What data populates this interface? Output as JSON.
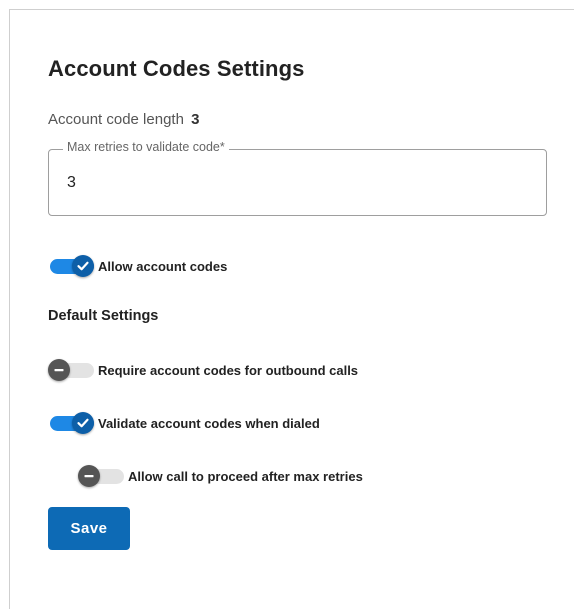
{
  "page": {
    "title": "Account Codes Settings"
  },
  "account_code_length": {
    "label": "Account code length",
    "value": "3"
  },
  "max_retries": {
    "label": "Max retries to validate code*",
    "value": "3"
  },
  "allow_account_codes": {
    "label": "Allow account codes",
    "checked": true
  },
  "default_settings": {
    "heading": "Default Settings",
    "require_outbound": {
      "label": "Require account codes for outbound calls",
      "checked": false
    },
    "validate_when_dialed": {
      "label": "Validate account codes when dialed",
      "checked": true
    },
    "allow_proceed_after_retries": {
      "label": "Allow call to proceed after max retries",
      "checked": false
    }
  },
  "actions": {
    "save_label": "Save"
  },
  "colors": {
    "toggle_on_track": "#1e88e5",
    "toggle_on_thumb": "#0d5fa8",
    "toggle_off_track": "#e3e3e3",
    "toggle_off_thumb": "#555555",
    "primary_button": "#0d6ab5"
  },
  "icons": {
    "toggle_on": "check-icon",
    "toggle_off": "minus-icon"
  }
}
